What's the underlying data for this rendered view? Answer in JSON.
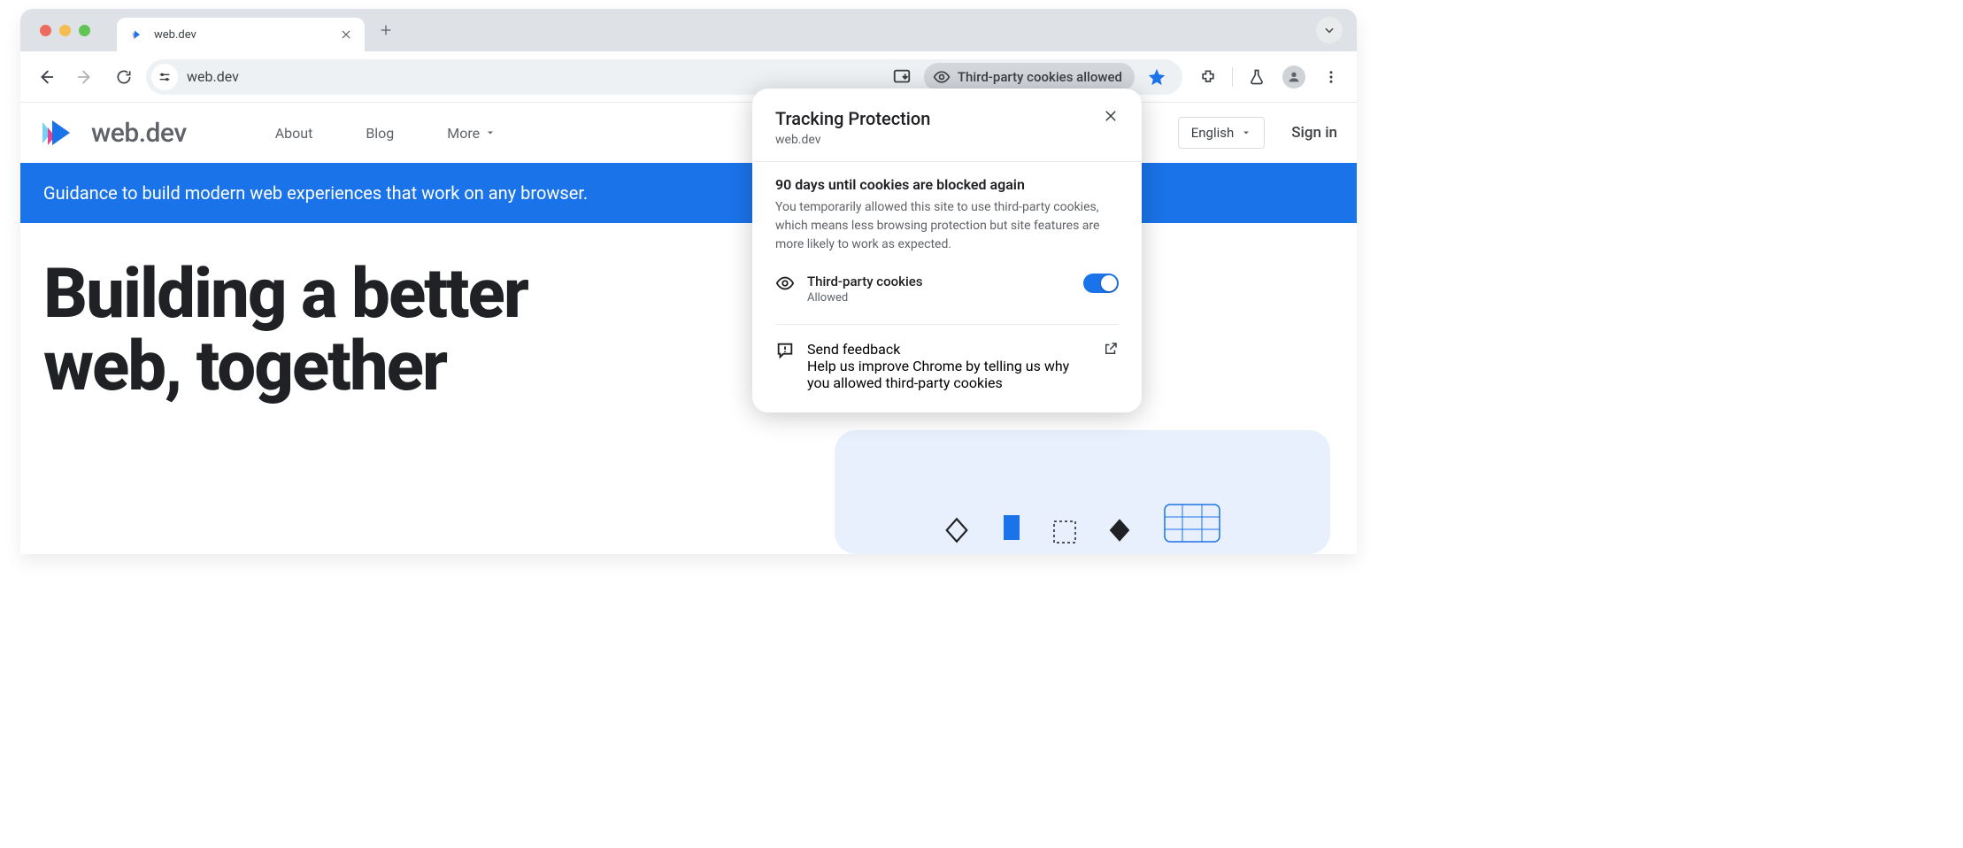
{
  "browser": {
    "tab_title": "web.dev",
    "url": "web.dev",
    "cookie_chip": "Third-party cookies allowed"
  },
  "popup": {
    "title": "Tracking Protection",
    "site": "web.dev",
    "heading": "90 days until cookies are blocked again",
    "body": "You temporarily allowed this site to use third-party cookies, which means less browsing protection but site features are more likely to work as expected.",
    "cookie_label": "Third-party cookies",
    "cookie_status": "Allowed",
    "feedback_title": "Send feedback",
    "feedback_body": "Help us improve Chrome by telling us why you allowed third-party cookies"
  },
  "site": {
    "brand": "web.dev",
    "nav": {
      "about": "About",
      "blog": "Blog",
      "more": "More"
    },
    "language": "English",
    "sign_in": "Sign in",
    "banner": "Guidance to build modern web experiences that work on any browser.",
    "hero_line1": "Building a better",
    "hero_line2": "web, together"
  }
}
